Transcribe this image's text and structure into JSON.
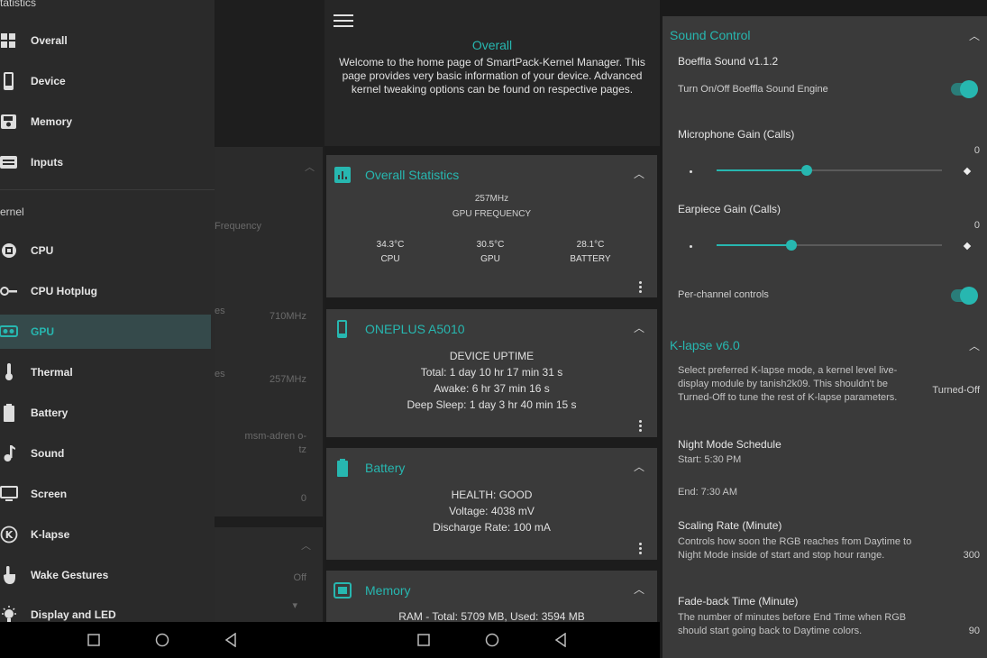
{
  "drawer": {
    "section_top": "tatistics",
    "section_kernel": "ernel",
    "items": [
      {
        "label": "Overall",
        "icon": "grid-icon"
      },
      {
        "label": "Device",
        "icon": "phone-icon"
      },
      {
        "label": "Memory",
        "icon": "memory-icon"
      },
      {
        "label": "Inputs",
        "icon": "inputs-icon"
      },
      {
        "label": "CPU",
        "icon": "cpu-icon"
      },
      {
        "label": "CPU Hotplug",
        "icon": "hotplug-icon"
      },
      {
        "label": "GPU",
        "icon": "gpu-icon"
      },
      {
        "label": "Thermal",
        "icon": "thermometer-icon"
      },
      {
        "label": "Battery",
        "icon": "battery-icon"
      },
      {
        "label": "Sound",
        "icon": "music-note-icon"
      },
      {
        "label": "Screen",
        "icon": "monitor-icon"
      },
      {
        "label": "K-lapse",
        "icon": "k-circle-icon"
      },
      {
        "label": "Wake Gestures",
        "icon": "hand-icon"
      },
      {
        "label": "Display and LED",
        "icon": "bulb-icon"
      }
    ]
  },
  "behind_drawer": {
    "freq_label": "Frequency",
    "v1_label": "es",
    "v1_value": "710MHz",
    "v2_label": "es",
    "v2_value": "257MHz",
    "governor": "msm-adren o-tz",
    "zero": "0",
    "off": "Off"
  },
  "overview": {
    "title": "Overall",
    "description": "Welcome to the home page of SmartPack-Kernel Manager. This page provides very basic information of your device. Advanced kernel tweaking options can be found on respective pages.",
    "stats_card": {
      "title": "Overall Statistics",
      "gpu_freq": "257MHz",
      "gpu_freq_label": "GPU FREQUENCY",
      "cpu_temp": "34.3°C",
      "cpu_label": "CPU",
      "gpu_temp": "30.5°C",
      "gpu_label": "GPU",
      "battery_temp": "28.1°C",
      "battery_label": "BATTERY"
    },
    "device_card": {
      "title": "ONEPLUS A5010",
      "uptime_label": "DEVICE UPTIME",
      "total": "Total: 1 day 10 hr 17 min 31 s",
      "awake": "Awake: 6 hr 37 min 16 s",
      "deep_sleep": "Deep Sleep: 1 day 3 hr 40 min 15 s"
    },
    "battery_card": {
      "title": "Battery",
      "health": "HEALTH: GOOD",
      "voltage": "Voltage: 4038 mV",
      "discharge": "Discharge Rate: 100 mA"
    },
    "memory_card": {
      "title": "Memory",
      "ram": "RAM - Total: 5709 MB, Used: 3594 MB"
    }
  },
  "sound": {
    "title": "Sound Control",
    "engine": "Boeffla Sound v1.1.2",
    "toggle_label": "Turn On/Off Boeffla Sound Engine",
    "mic_gain_label": "Microphone Gain (Calls)",
    "mic_gain_value": "0",
    "mic_gain_level": 0.4,
    "earpiece_gain_label": "Earpiece Gain (Calls)",
    "earpiece_gain_value": "0",
    "earpiece_gain_level": 0.33,
    "per_channel_label": "Per-channel controls"
  },
  "klapse": {
    "title": "K-lapse v6.0",
    "mode_desc": "Select preferred K-lapse mode, a kernel level live-display module by tanish2k09. This shouldn't be Turned-Off to tune the rest of K-lapse parameters.",
    "mode_value": "Turned-Off",
    "night_title": "Night Mode Schedule",
    "start": "Start: 5:30 PM",
    "end": "End: 7:30 AM",
    "scaling_title": "Scaling Rate (Minute)",
    "scaling_desc": "Controls how soon the RGB reaches from Daytime to Night Mode inside of start and stop hour range.",
    "scaling_value": "300",
    "fade_title": "Fade-back Time (Minute)",
    "fade_desc": "The number of minutes before End Time when RGB should start going back to Daytime colors.",
    "fade_value": "90"
  },
  "colors": {
    "accent": "#27b7b0",
    "card": "#3a3a3a",
    "drawer": "#2a2a2a",
    "active": "#354a4b"
  }
}
